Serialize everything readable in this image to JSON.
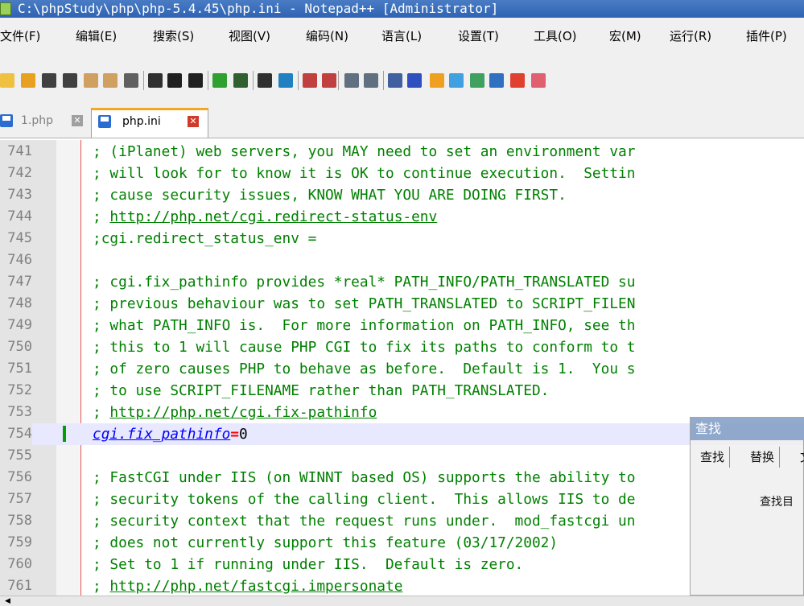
{
  "window": {
    "title": "C:\\phpStudy\\php\\php-5.4.45\\php.ini - Notepad++ [Administrator]"
  },
  "menu": [
    {
      "label": "文件(F)"
    },
    {
      "label": "编辑(E)"
    },
    {
      "label": "搜索(S)"
    },
    {
      "label": "视图(V)"
    },
    {
      "label": "编码(N)"
    },
    {
      "label": "语言(L)"
    },
    {
      "label": "设置(T)"
    },
    {
      "label": "工具(O)"
    },
    {
      "label": "宏(M)"
    },
    {
      "label": "运行(R)"
    },
    {
      "label": "插件(P)"
    }
  ],
  "toolbar": {
    "buttons": [
      {
        "icon": "new-file-icon",
        "color": "#f0c040"
      },
      {
        "icon": "open-file-icon",
        "color": "#e8a020"
      },
      {
        "icon": "save-icon",
        "color": "#404040"
      },
      {
        "icon": "save-all-icon",
        "color": "#404040"
      },
      {
        "icon": "close-icon",
        "color": "#d0a060"
      },
      {
        "icon": "close-all-icon",
        "color": "#d0a060"
      },
      {
        "icon": "print-icon",
        "color": "#606060"
      },
      {
        "icon": "cut-icon",
        "color": "#303030"
      },
      {
        "icon": "copy-icon",
        "color": "#202020"
      },
      {
        "icon": "paste-icon",
        "color": "#202020"
      },
      {
        "icon": "undo-icon",
        "color": "#30a030"
      },
      {
        "icon": "redo-icon",
        "color": "#306030"
      },
      {
        "icon": "find-icon",
        "color": "#303030"
      },
      {
        "icon": "replace-icon",
        "color": "#2080c0"
      },
      {
        "icon": "zoom-in-icon",
        "color": "#c04040"
      },
      {
        "icon": "zoom-out-icon",
        "color": "#c04040"
      },
      {
        "icon": "sync-vertical-icon",
        "color": "#607080"
      },
      {
        "icon": "sync-horizontal-icon",
        "color": "#607080"
      },
      {
        "icon": "word-wrap-icon",
        "color": "#4060a0"
      },
      {
        "icon": "show-all-chars-icon",
        "color": "#3050c0"
      },
      {
        "icon": "indent-guide-icon",
        "color": "#f0a020"
      },
      {
        "icon": "user-lang-icon",
        "color": "#40a0e0"
      },
      {
        "icon": "doc-map-icon",
        "color": "#40a060"
      },
      {
        "icon": "function-list-icon",
        "color": "#3070c0"
      },
      {
        "icon": "folder-workspace-icon",
        "color": "#e04030"
      },
      {
        "icon": "monitoring-icon",
        "color": "#e06070"
      }
    ]
  },
  "tabs": [
    {
      "label": "1.php",
      "active": false
    },
    {
      "label": "php.ini",
      "active": true
    }
  ],
  "editor": {
    "lines": [
      {
        "num": "741",
        "text": "; (iPlanet) web servers, you MAY need to set an environment var"
      },
      {
        "num": "742",
        "text": "; will look for to know it is OK to continue execution.  Settin"
      },
      {
        "num": "743",
        "text": "; cause security issues, KNOW WHAT YOU ARE DOING FIRST."
      },
      {
        "num": "744",
        "text": "; ",
        "link": "http://php.net/cgi.redirect-status-env"
      },
      {
        "num": "745",
        "text": ";cgi.redirect_status_env ="
      },
      {
        "num": "746",
        "text": ""
      },
      {
        "num": "747",
        "text": "; cgi.fix_pathinfo provides *real* PATH_INFO/PATH_TRANSLATED su"
      },
      {
        "num": "748",
        "text": "; previous behaviour was to set PATH_TRANSLATED to SCRIPT_FILEN"
      },
      {
        "num": "749",
        "text": "; what PATH_INFO is.  For more information on PATH_INFO, see th"
      },
      {
        "num": "750",
        "text": "; this to 1 will cause PHP CGI to fix its paths to conform to t"
      },
      {
        "num": "751",
        "text": "; of zero causes PHP to behave as before.  Default is 1.  You s"
      },
      {
        "num": "752",
        "text": "; to use SCRIPT_FILENAME rather than PATH_TRANSLATED."
      },
      {
        "num": "753",
        "text": "; ",
        "link": "http://php.net/cgi.fix-pathinfo"
      },
      {
        "num": "754",
        "key": "cgi.fix_pathinfo",
        "eq": "=",
        "val": "0",
        "current": true
      },
      {
        "num": "755",
        "text": ""
      },
      {
        "num": "756",
        "text": "; FastCGI under IIS (on WINNT based OS) supports the ability to"
      },
      {
        "num": "757",
        "text": "; security tokens of the calling client.  This allows IIS to de"
      },
      {
        "num": "758",
        "text": "; security context that the request runs under.  mod_fastcgi un"
      },
      {
        "num": "759",
        "text": "; does not currently support this feature (03/17/2002)"
      },
      {
        "num": "760",
        "text": "; Set to 1 if running under IIS.  Default is zero."
      },
      {
        "num": "761",
        "text": "; ",
        "link": "http://php.net/fastcgi.impersonate"
      }
    ]
  },
  "find_dialog": {
    "title": "查找",
    "tabs": [
      "查找",
      "替换",
      "文"
    ],
    "label": "查找目"
  },
  "colors": {
    "comment": "#008000",
    "keyword": "#0000ff",
    "operator": "#ff0000",
    "current_line": "#e8e8ff",
    "edge_line": "#e05050",
    "tab_accent": "#f5a623"
  }
}
